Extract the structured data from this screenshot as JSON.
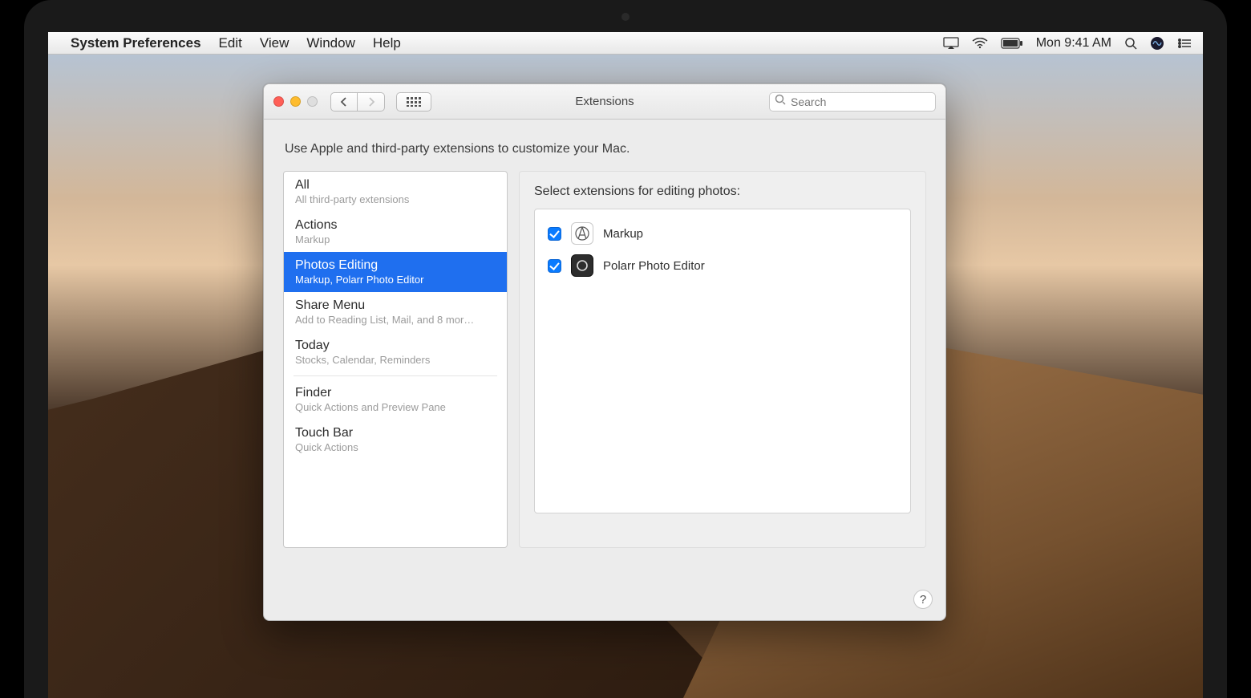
{
  "menubar": {
    "app_name": "System Preferences",
    "items": [
      "Edit",
      "View",
      "Window",
      "Help"
    ],
    "clock": "Mon 9:41 AM"
  },
  "window": {
    "title": "Extensions",
    "search_placeholder": "Search",
    "intro": "Use Apple and third-party extensions to customize your Mac.",
    "help_label": "?"
  },
  "sidebar": {
    "items": [
      {
        "title": "All",
        "sub": "All third-party extensions",
        "selected": false
      },
      {
        "title": "Actions",
        "sub": "Markup",
        "selected": false
      },
      {
        "title": "Photos Editing",
        "sub": "Markup, Polarr Photo Editor",
        "selected": true
      },
      {
        "title": "Share Menu",
        "sub": "Add to Reading List, Mail, and 8 mor…",
        "selected": false
      },
      {
        "title": "Today",
        "sub": "Stocks, Calendar, Reminders",
        "selected": false
      },
      {
        "title": "Finder",
        "sub": "Quick Actions and Preview Pane",
        "selected": false
      },
      {
        "title": "Touch Bar",
        "sub": "Quick Actions",
        "selected": false
      }
    ]
  },
  "detail": {
    "heading": "Select extensions for editing photos:",
    "rows": [
      {
        "name": "Markup",
        "checked": true,
        "icon": "markup-icon"
      },
      {
        "name": "Polarr Photo Editor",
        "checked": true,
        "icon": "polarr-icon"
      }
    ]
  }
}
